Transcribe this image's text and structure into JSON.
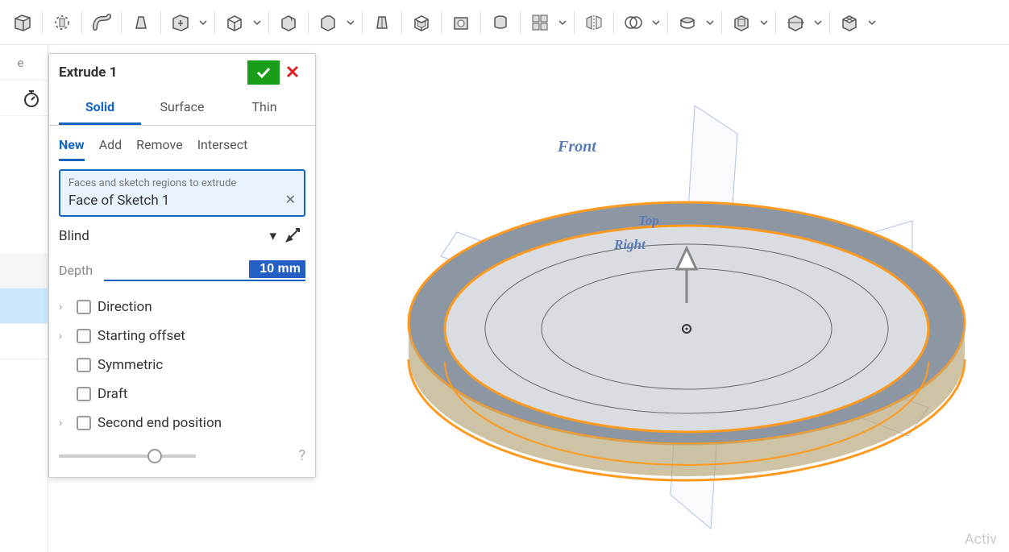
{
  "toolbar": {
    "icons": [
      "cube",
      "radiate",
      "pipe",
      "loft",
      "pattern",
      "box",
      "shell",
      "fillet",
      "chamfer",
      "box2",
      "wrap",
      "revolve",
      "cylinder",
      "bool1",
      "plane",
      "bool",
      "combine",
      "sketch",
      "feature",
      "mirror",
      "array",
      "thread"
    ]
  },
  "panel": {
    "title": "Extrude 1",
    "tabs": {
      "solid": "Solid",
      "surface": "Surface",
      "thin": "Thin"
    },
    "subtabs": {
      "new": "New",
      "add": "Add",
      "remove": "Remove",
      "intersect": "Intersect"
    },
    "selection": {
      "label": "Faces and sketch regions to extrude",
      "value": "Face of Sketch 1"
    },
    "end_type": "Blind",
    "depth_label": "Depth",
    "depth_value": "10 mm",
    "opts": {
      "direction": "Direction",
      "starting_offset": "Starting offset",
      "symmetric": "Symmetric",
      "draft": "Draft",
      "second_end": "Second end position"
    }
  },
  "viewport": {
    "front": "Front",
    "top": "Top",
    "right": "Right"
  },
  "watermark": "Activ"
}
